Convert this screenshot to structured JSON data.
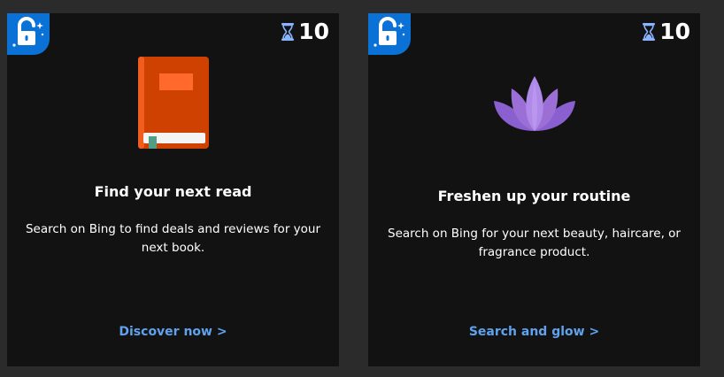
{
  "colors": {
    "page_bg": "#2b2b2b",
    "card_bg": "#121212",
    "badge_blue": "#0a72d6",
    "link": "#5fa2ee",
    "book_orange": "#cf4100",
    "lotus_purple": "#9b6fd6"
  },
  "cards": [
    {
      "badge_icon": "unlocked-padlock-icon",
      "points_icon": "hourglass-icon",
      "points": "10",
      "image": "book-icon",
      "title": "Find your next read",
      "description": "Search on Bing to find deals and reviews for your next book.",
      "cta": "Discover now >"
    },
    {
      "badge_icon": "unlocked-padlock-icon",
      "points_icon": "hourglass-icon",
      "points": "10",
      "image": "lotus-icon",
      "title": "Freshen up your routine",
      "description": "Search on Bing for your next beauty, haircare, or fragrance product.",
      "cta": "Search and glow >"
    }
  ]
}
